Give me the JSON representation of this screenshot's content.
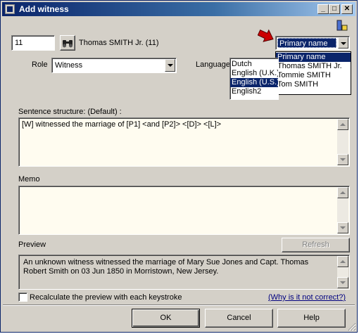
{
  "window": {
    "title": "Add witness"
  },
  "person": {
    "id_value": "11",
    "name": "Thomas SMITH Jr. (11)"
  },
  "role": {
    "label": "Role",
    "value": "Witness"
  },
  "language": {
    "label": "Language",
    "options": [
      "Dutch",
      "English (U.K.)",
      "English (U.S.)",
      "English2"
    ],
    "selected_index": 2
  },
  "name_select": {
    "value": "Primary name",
    "options": [
      "Primary name",
      "Thomas SMITH Jr.",
      "Tommie SMITH",
      "Tom SMITH"
    ],
    "selected_index": 0
  },
  "sentence": {
    "label": "Sentence structure: (Default) :",
    "value": "[W] witnessed the marriage of [P1] <and [P2]> <[D]> <[L]>"
  },
  "memo": {
    "label": "Memo",
    "value": ""
  },
  "preview": {
    "label": "Preview",
    "refresh_label": "Refresh",
    "text": "An unknown witness witnessed the marriage of Mary Sue Jones and Capt. Thomas Robert Smith on 03 Jun 1850 in Morristown, New Jersey."
  },
  "recalc": {
    "label": "Recalculate the preview with each keystroke",
    "checked": false
  },
  "why_link": "(Why is it not correct?)",
  "buttons": {
    "ok": "OK",
    "cancel": "Cancel",
    "help": "Help"
  },
  "title_buttons": {
    "minimize": "_",
    "maximize": "□",
    "close": "✕"
  },
  "colors": {
    "title": "#0a246a",
    "face": "#d4d0c8",
    "field_bg": "#fffcf0",
    "selection": "#0a246a",
    "arrow": "#cc0000"
  }
}
